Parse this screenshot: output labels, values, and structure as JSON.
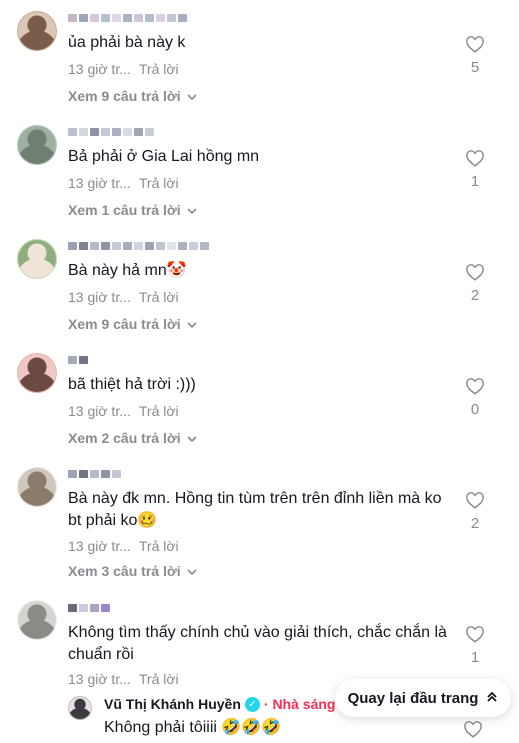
{
  "comments": [
    {
      "text": "ủa phải bà này k",
      "time": "13 giờ tr...",
      "reply_label": "Trả lời",
      "view_replies": "Xem 9 câu trả lời",
      "likes": "5",
      "avatar_colors": [
        "#d9c8b8",
        "#7a5c4a",
        "#c9a88e"
      ],
      "username_colors": [
        "#c7b4c8",
        "#9aa5b8",
        "#d6c7d9",
        "#b7c0cf",
        "#e1d6e2",
        "#a8b3c4",
        "#cfc3d6",
        "#b5bccb",
        "#d9d1dc",
        "#c0c6d2",
        "#a7aebf"
      ]
    },
    {
      "text": "Bả phải ở Gia Lai hồng mn",
      "time": "13 giờ tr...",
      "reply_label": "Trả lời",
      "view_replies": "Xem 1 câu trả lời",
      "likes": "1",
      "avatar_colors": [
        "#9fb0a0",
        "#6f7f70",
        "#b8c6c6"
      ],
      "username_colors": [
        "#b8bfca",
        "#d2d6dd",
        "#8b93a3",
        "#c4cad5",
        "#a9b0be",
        "#d9dde3",
        "#9ea6b4",
        "#c8cdd6"
      ]
    },
    {
      "text": "Bà này hả mn",
      "emoji": "🤡",
      "time": "13 giờ tr...",
      "reply_label": "Trả lời",
      "view_replies": "Xem 9 câu trả lời",
      "likes": "2",
      "avatar_colors": [
        "#8fae7d",
        "#f0e4d8",
        "#c9d7bc"
      ],
      "username_colors": [
        "#9aa2b1",
        "#7c8494",
        "#b4bac6",
        "#8e96a6",
        "#c5cbd4",
        "#a6adbb",
        "#d0d4dc",
        "#9ba3b2",
        "#bfc5cf",
        "#e0e3e8",
        "#aab1be",
        "#c9ced7",
        "#b1b8c4"
      ]
    },
    {
      "text": "bã thiệt hả trời :)))",
      "time": "13 giờ tr...",
      "reply_label": "Trả lời",
      "view_replies": "Xem 2 câu trả lời",
      "likes": "0",
      "avatar_colors": [
        "#f1c7c6",
        "#6b4a44",
        "#e9b1aa"
      ],
      "username_colors": [
        "#a3aab8",
        "#6e7686"
      ]
    },
    {
      "text": "Bà này đk mn. Hồng tin tùm trên trên đỉnh liền mà ko bt phải ko",
      "emoji": "🥴",
      "time": "13 giờ tr...",
      "reply_label": "Trả lời",
      "view_replies": "Xem 3 câu trả lời",
      "likes": "2",
      "avatar_colors": [
        "#cfc7bd",
        "#8a7b6a",
        "#efebe6"
      ],
      "username_colors": [
        "#9ba2b0",
        "#6c7383",
        "#b7bdc8",
        "#8d94a3",
        "#c3c8d1"
      ]
    },
    {
      "text": "Không tìm thấy chính chủ vào giải thích, chắc chắn là chuẩn rồi",
      "time": "13 giờ tr...",
      "reply_label": "Trả lời",
      "likes": "1",
      "avatar_colors": [
        "#d6d4d0",
        "#8b8a86",
        "#f1f0ee"
      ],
      "username_colors": [
        "#6b6b78",
        "#c7c9dc",
        "#a5a7c9",
        "#9c87c8"
      ]
    }
  ],
  "reply": {
    "name": "Vũ Thị Khánh Huyền",
    "creator_tag": "· Nhà sáng",
    "text": "Không phải tôiiii 🤣🤣🤣",
    "avatar_colors": [
      "#e8e3df",
      "#3b3b46",
      "#c8b8ae"
    ]
  },
  "back_to_top": {
    "label": "Quay lại đầu trang",
    "icon": "double-chevron-up-icon"
  },
  "colors": {
    "text_primary": "#161823",
    "text_secondary": "#8a8b91",
    "creator_red": "#fe2c55",
    "verified": "#20d5ec"
  }
}
